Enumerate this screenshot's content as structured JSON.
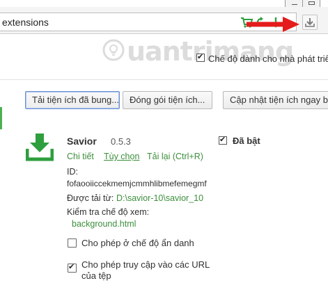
{
  "toolbar": {
    "address": "extensions",
    "icons": [
      "cart-icon",
      "refresh-icon",
      "arrow-down-icon",
      "download-icon"
    ]
  },
  "watermark": {
    "text": "uantrimang"
  },
  "developer_mode": {
    "label": "Chế độ dành cho nhà phát triển",
    "checked": true
  },
  "buttons": {
    "load_unpacked": "Tải tiện ích đã bung...",
    "pack": "Đóng gói tiện ích...",
    "update": "Cập nhật tiện ích ngay bây"
  },
  "extension": {
    "name": "Savior",
    "version": "0.5.3",
    "enabled_label": "Đã bật",
    "enabled": true,
    "links": {
      "details": "Chi tiết",
      "options": "Tùy chọn",
      "reload": "Tải lại (Ctrl+R)"
    },
    "id_label": "ID:",
    "id_value": "fofaooiiccekmemjcmmhlibmefemegmf",
    "loaded_from_label": "Được tải từ:",
    "loaded_from_path": "D:\\savior-10\\savior_10",
    "inspect_label": "Kiểm tra chế độ xem:",
    "inspect_link": "background.html",
    "allow_incognito": {
      "label": "Cho phép ở chế độ ẩn danh",
      "checked": false
    },
    "allow_file_urls": {
      "label": "Cho phép truy cập vào các URL của tệp",
      "checked": true
    }
  },
  "colors": {
    "link_green": "#3c8f3c",
    "arrow_red": "#e51c1c",
    "icon_green": "#2e9e3e"
  }
}
